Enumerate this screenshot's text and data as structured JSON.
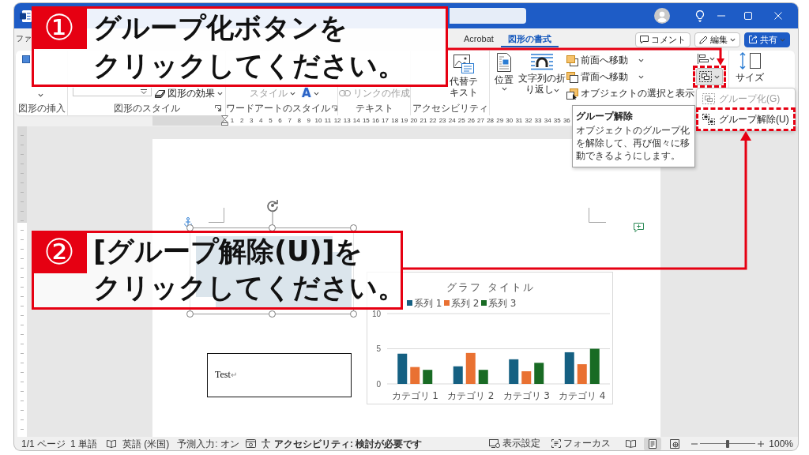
{
  "menu_tabs": [
    {
      "label": "ファ",
      "selected": false
    },
    {
      "label": "Acrobat",
      "selected": false
    },
    {
      "label": "図形の書式",
      "selected": true
    }
  ],
  "header_buttons": [
    {
      "kind": "comment",
      "label": "コメント"
    },
    {
      "kind": "edit",
      "label": "編集"
    },
    {
      "kind": "share",
      "label": "共有"
    }
  ],
  "ribbon": {
    "insert_shapes": {
      "label": "図形の挿入"
    },
    "shape_styles": {
      "label": "図形のスタイル",
      "effects": "図形の効果"
    },
    "wordart_styles": {
      "label": "ワードアートのスタイル",
      "quick_styles": {
        "label": "スタイル",
        "disabled": true
      },
      "text_effects": "A"
    },
    "text": {
      "label": "テキスト",
      "create_link": {
        "label": "リンクの作成",
        "disabled": true
      }
    },
    "accessibility": {
      "label": "アクセシビリティ",
      "alt_text": "代替テキスト"
    },
    "arrange": {
      "position": "位置",
      "wrap_text": "文字列の折り返し",
      "bring_forward": "前面へ移動",
      "send_backward": "背面へ移動",
      "selection_pane": "オブジェクトの選択と表示",
      "group_button": {
        "expanded": true
      }
    },
    "size": {
      "label": "サイズ"
    }
  },
  "group_menu": {
    "items": [
      {
        "kind": "group",
        "label": "グループ化(G)",
        "disabled": true
      },
      {
        "kind": "ungroup",
        "label": "グループ解除(U)",
        "disabled": false
      }
    ]
  },
  "tooltip": {
    "title": "グループ解除",
    "description": "オブジェクトのグループ化を解除して、再び個々に移動できるようにします。"
  },
  "ruler": {
    "numbers": [
      "1",
      "2",
      "3",
      "4",
      "5",
      "6",
      "7",
      "8",
      "9",
      "10",
      "11",
      "12",
      "13",
      "14",
      "15",
      "16",
      "17",
      "18",
      "19",
      "20",
      "21",
      "22",
      "23",
      "24",
      "25",
      "26",
      "27",
      "28",
      "29",
      "30",
      "31",
      "32",
      "33",
      "34",
      "35",
      "36"
    ]
  },
  "document": {
    "chart": {
      "chart_data": {
        "type": "bar",
        "title": "グラフ タイトル",
        "legend": "top",
        "categories": [
          "カテゴリ 1",
          "カテゴリ 2",
          "カテゴリ 3",
          "カテゴリ 4"
        ],
        "series": [
          {
            "name": "系列 1",
            "color": "#156082",
            "values": [
              4.3,
              2.5,
              3.5,
              4.5
            ]
          },
          {
            "name": "系列 2",
            "color": "#e97132",
            "values": [
              2.4,
              4.4,
              1.8,
              2.8
            ]
          },
          {
            "name": "系列 3",
            "color": "#196b24",
            "values": [
              2,
              2,
              3,
              5
            ]
          }
        ],
        "ylim": [
          0,
          10
        ],
        "yticks": [
          0,
          5,
          10
        ]
      }
    },
    "text_box": {
      "text": "Test",
      "mark": "↵"
    }
  },
  "callouts": [
    {
      "number": "①",
      "lines": [
        "グループ化ボタンを",
        "クリックしてください。"
      ]
    },
    {
      "number": "②",
      "lines": [
        "[グループ解除(U)]を",
        "クリックしてください。"
      ]
    }
  ],
  "status_bar": {
    "page": "1/1 ページ",
    "words": "1 単語",
    "language": "英語 (米国)",
    "prediction": "予測入力: オン",
    "accessibility": "アクセシビリティ: 検討が必要です",
    "display_settings": "表示設定",
    "focus": "フォーカス",
    "views": [
      {
        "kind": "read",
        "selected": false
      },
      {
        "kind": "print",
        "selected": true
      },
      {
        "kind": "web",
        "selected": false
      }
    ],
    "zoom": {
      "level": 0.5,
      "reading": "100%"
    }
  }
}
